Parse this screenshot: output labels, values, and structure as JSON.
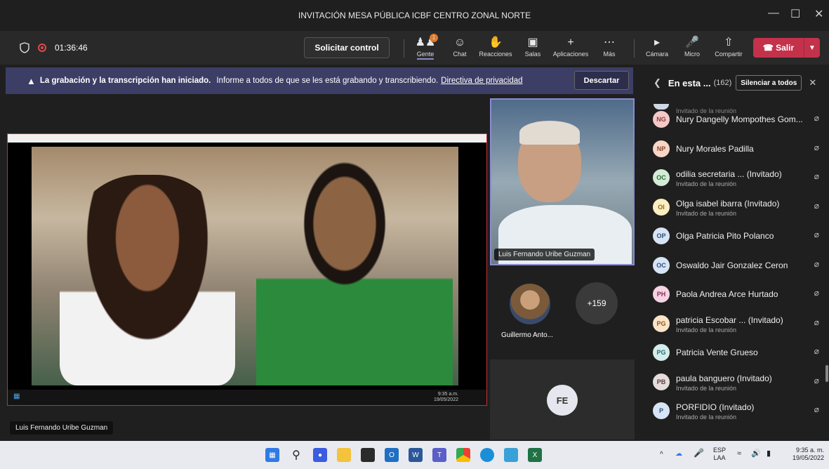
{
  "window": {
    "title": "INVITACIÓN MESA PÚBLICA ICBF CENTRO ZONAL NORTE",
    "minimize": "—",
    "maximize": "☐",
    "close": "✕"
  },
  "toolbar": {
    "timer": "01:36:46",
    "control_button": "Solicitar control",
    "tools": [
      {
        "label": "Gente",
        "icon": "people-icon",
        "badge": "1"
      },
      {
        "label": "Chat",
        "icon": "chat-icon"
      },
      {
        "label": "Reacciones",
        "icon": "reactions-icon"
      },
      {
        "label": "Salas",
        "icon": "rooms-icon"
      },
      {
        "label": "Aplicaciones",
        "icon": "plus-icon"
      },
      {
        "label": "Más",
        "icon": "more-icon"
      },
      {
        "label": "Cámara",
        "icon": "camera-off-icon"
      },
      {
        "label": "Micro",
        "icon": "mic-off-icon"
      },
      {
        "label": "Compartir",
        "icon": "share-icon"
      }
    ],
    "leave_button": "Salir"
  },
  "banner": {
    "bold": "La grabación y la transcripción han iniciado.",
    "text": "Informe a todos de que se les está grabando y transcribiendo.",
    "link": "Directiva de privacidad",
    "dismiss": "Descartar"
  },
  "stage": {
    "presenter_label": "Luis Fernando Uribe Guzman",
    "mini_time": "9:35 a.m.",
    "mini_date": "19/05/2022"
  },
  "tiles": {
    "main_name": "Luis Fernando Uribe Guzman",
    "guest_name": "Guillermo Anto...",
    "more_count": "+159",
    "fe_initials": "FE"
  },
  "panel": {
    "title": "En esta ...",
    "count": "(162)",
    "mute_all": "Silenciar a todos",
    "participants": [
      {
        "initials": "NG",
        "name": "Nury Dangelly Mompothes Gom...",
        "sub": "",
        "color": "#f4c8c8",
        "fg": "#8a3b3b"
      },
      {
        "initials": "NP",
        "name": "Nury Morales Padilla",
        "sub": "",
        "color": "#f7d6c7",
        "fg": "#8a4b2b"
      },
      {
        "initials": "OC",
        "name": "odilia secretaria ... (Invitado)",
        "sub": "Invitado de la reunión",
        "color": "#d3ecd6",
        "fg": "#2d6b3a"
      },
      {
        "initials": "OI",
        "name": "Olga isabel ibarra (Invitado)",
        "sub": "Invitado de la reunión",
        "color": "#fbeec2",
        "fg": "#8a6a1a"
      },
      {
        "initials": "OP",
        "name": "Olga Patricia Pito Polanco",
        "sub": "",
        "color": "#d6e4f5",
        "fg": "#2e4f7a"
      },
      {
        "initials": "OC",
        "name": "Oswaldo Jair Gonzalez Ceron",
        "sub": "",
        "color": "#d6e4f5",
        "fg": "#2e4f7a"
      },
      {
        "initials": "PH",
        "name": "Paola Andrea Arce Hurtado",
        "sub": "",
        "color": "#f5d3e2",
        "fg": "#8a2e5a"
      },
      {
        "initials": "PG",
        "name": "patricia Escobar ... (Invitado)",
        "sub": "Invitado de la reunión",
        "color": "#fbe3c8",
        "fg": "#8a5a1a"
      },
      {
        "initials": "PG",
        "name": "Patricia Vente Grueso",
        "sub": "",
        "color": "#d3ecec",
        "fg": "#2d6b6b"
      },
      {
        "initials": "PB",
        "name": "paula banguero (Invitado)",
        "sub": "Invitado de la reunión",
        "color": "#e6dcdc",
        "fg": "#5a4040"
      },
      {
        "initials": "P",
        "name": "PORFIDIO (Invitado)",
        "sub": "Invitado de la reunión",
        "color": "#d6e4f5",
        "fg": "#2e4f7a"
      }
    ],
    "partial_top": "Invitado de la reunión"
  },
  "taskbar": {
    "lang_top": "ESP",
    "lang_bottom": "LAA",
    "time": "9:35 a. m.",
    "date": "19/05/2022"
  }
}
